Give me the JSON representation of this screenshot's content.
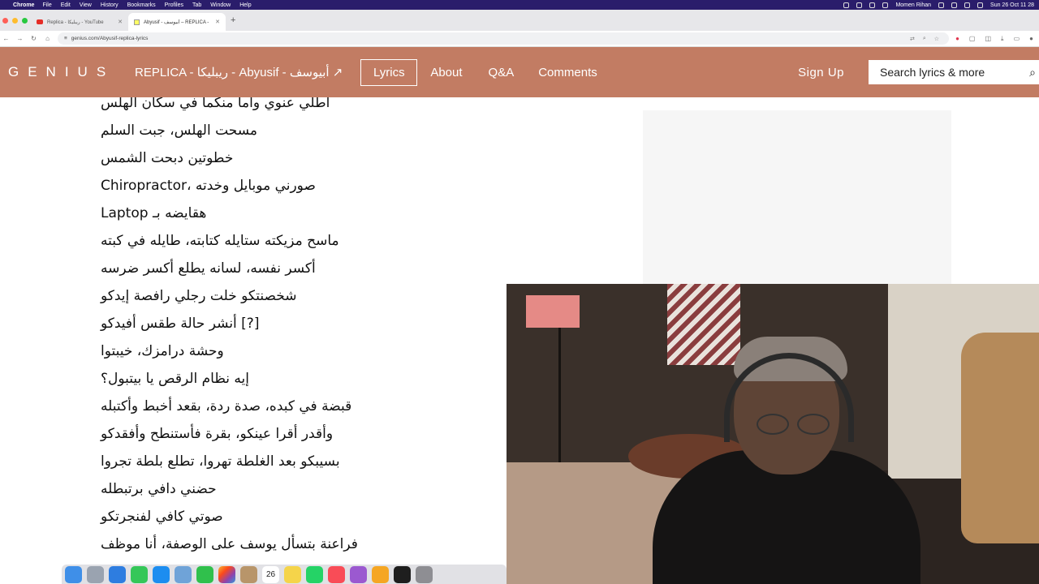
{
  "menubar": {
    "app": "Chrome",
    "items": [
      "File",
      "Edit",
      "View",
      "History",
      "Bookmarks",
      "Profiles",
      "Tab",
      "Window",
      "Help"
    ],
    "user": "Momen Rihan",
    "datetime": "Sun 26 Oct  11 28"
  },
  "tabs": [
    {
      "title": "Replica - ريبليكا - YouTube",
      "icon": "youtube-icon",
      "active": false
    },
    {
      "title": "Abyusif - أبيوسف – REPLICA -",
      "icon": "genius-icon",
      "active": true
    }
  ],
  "address": {
    "url": "genius.com/Abyusif-replica-lyrics"
  },
  "header": {
    "logo": "GENIUS",
    "song_title": "REPLICA - ريبليكا - Abyusif - أبيوسف ↗",
    "nav": {
      "lyrics": "Lyrics",
      "about": "About",
      "qa": "Q&A",
      "comments": "Comments"
    },
    "sign_up": "Sign Up",
    "search_placeholder": "Search lyrics & more"
  },
  "lyrics": [
    "أطلي عنوي وأما منكما في سكان الهلس",
    "مسحت الهلس، جبت السلم",
    "خطوتين دبحت الشمس",
    "Chiropractor، صورني موبايل وخدته",
    "هقايضه بـ Laptop",
    "ماسح مزيكته ستايله كتابته، طايله في كبته",
    "أكسر نفسه، لسانه يطلع أكسر ضرسه",
    "شخصنتكو خلت رجلي رافصة إيدكو",
    "[?] أنشر حالة طقس أفيدكو",
    "وحشة درامزك، خيبتوا",
    "إيه نظام الرقص يا بيتبول؟",
    "قبضة في كبده، صدة ردة، بقعد أخبط وأكتبله",
    "وأقدر أقرا عينكو، بقرة فأستنطح وأفقدكو",
    "بسيبكو بعد الغلطة تهروا، تطلع بلطة تجروا",
    "حضني دافي برتبطله",
    "صوتي كافي لفنجرتكو",
    "فراعنة بتسأل يوسف على الوصفة، أنا موظف"
  ],
  "colors": {
    "genius_header": "#c27c63",
    "menubar": "#2a1d6b"
  },
  "dock_icons": [
    "finder-icon",
    "launchpad-icon",
    "safari-icon",
    "facetime-icon",
    "app-store-icon",
    "preview-icon",
    "messages-icon",
    "photos-icon",
    "contacts-icon",
    "calendar-icon",
    "notes-icon",
    "whatsapp-icon",
    "music-icon",
    "podcasts-icon",
    "pages-icon",
    "terminal-icon",
    "settings-icon"
  ],
  "dock_calendar_day": "26"
}
